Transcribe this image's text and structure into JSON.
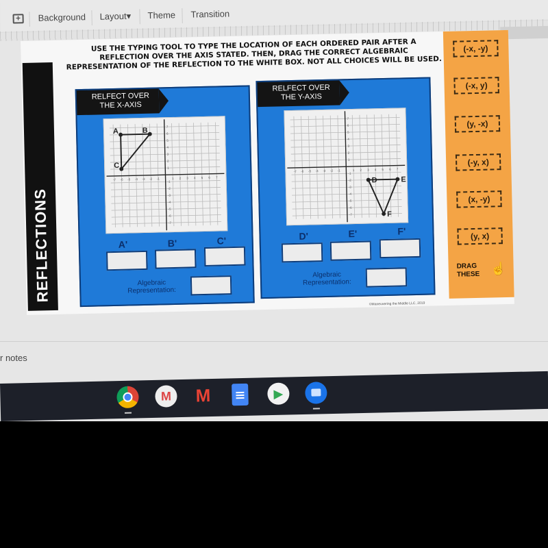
{
  "toolbar": {
    "items": [
      "Background",
      "Layout",
      "Theme",
      "Transition"
    ],
    "layout_caret": "▾"
  },
  "slide": {
    "side_title": "REFLECTIONS",
    "instructions": [
      "USE THE TYPING TOOL TO TYPE THE LOCATION OF EACH ORDERED PAIR AFTER A",
      "REFLECTION OVER THE AXIS STATED. THEN, DRAG THE CORRECT ALGEBRAIC",
      "REPRESENTATION OF THE REFLECTION TO THE WHITE BOX. NOT ALL CHOICES WILL BE USED."
    ],
    "panels": [
      {
        "tag_line1": "RELFECT OVER",
        "tag_line2": "THE X-AXIS",
        "axis_range": [
          -7,
          7
        ],
        "points": [
          {
            "label": "A",
            "x": -6,
            "y": 6
          },
          {
            "label": "B",
            "x": -2,
            "y": 6
          },
          {
            "label": "C",
            "x": -6,
            "y": 1
          }
        ],
        "answer_labels": [
          "A'",
          "B'",
          "C'"
        ],
        "answer_values": [
          "",
          "",
          ""
        ],
        "algebraic_label_line1": "Algebraic",
        "algebraic_label_line2": "Representation:",
        "algebraic_value": ""
      },
      {
        "tag_line1": "RELFECT OVER",
        "tag_line2": "THE Y-AXIS",
        "axis_range": [
          -7,
          7
        ],
        "points": [
          {
            "label": "D",
            "x": 3,
            "y": -2
          },
          {
            "label": "E",
            "x": 7,
            "y": -2
          },
          {
            "label": "F",
            "x": 5,
            "y": -7
          }
        ],
        "answer_labels": [
          "D'",
          "E'",
          "F'"
        ],
        "answer_values": [
          "",
          "",
          ""
        ],
        "algebraic_label_line1": "Algebraic",
        "algebraic_label_line2": "Representation:",
        "algebraic_value": ""
      }
    ],
    "choices": [
      "(-x, -y)",
      "(-x, y)",
      "(y, -x)",
      "(-y, x)",
      "(x, -y)",
      "(y, x)"
    ],
    "drag_label_line1": "DRAG",
    "drag_label_line2": "THESE",
    "copyright": "©Maneuvering the Middle LLC, 2019"
  },
  "speaker_notes_label": "r notes",
  "shelf_apps": [
    "chrome",
    "gmail",
    "gmail-new",
    "docs",
    "play-store",
    "files"
  ],
  "colors": {
    "panel_blue": "#1f7ad8",
    "drag_orange": "#f4a445",
    "title_black": "#111111"
  }
}
